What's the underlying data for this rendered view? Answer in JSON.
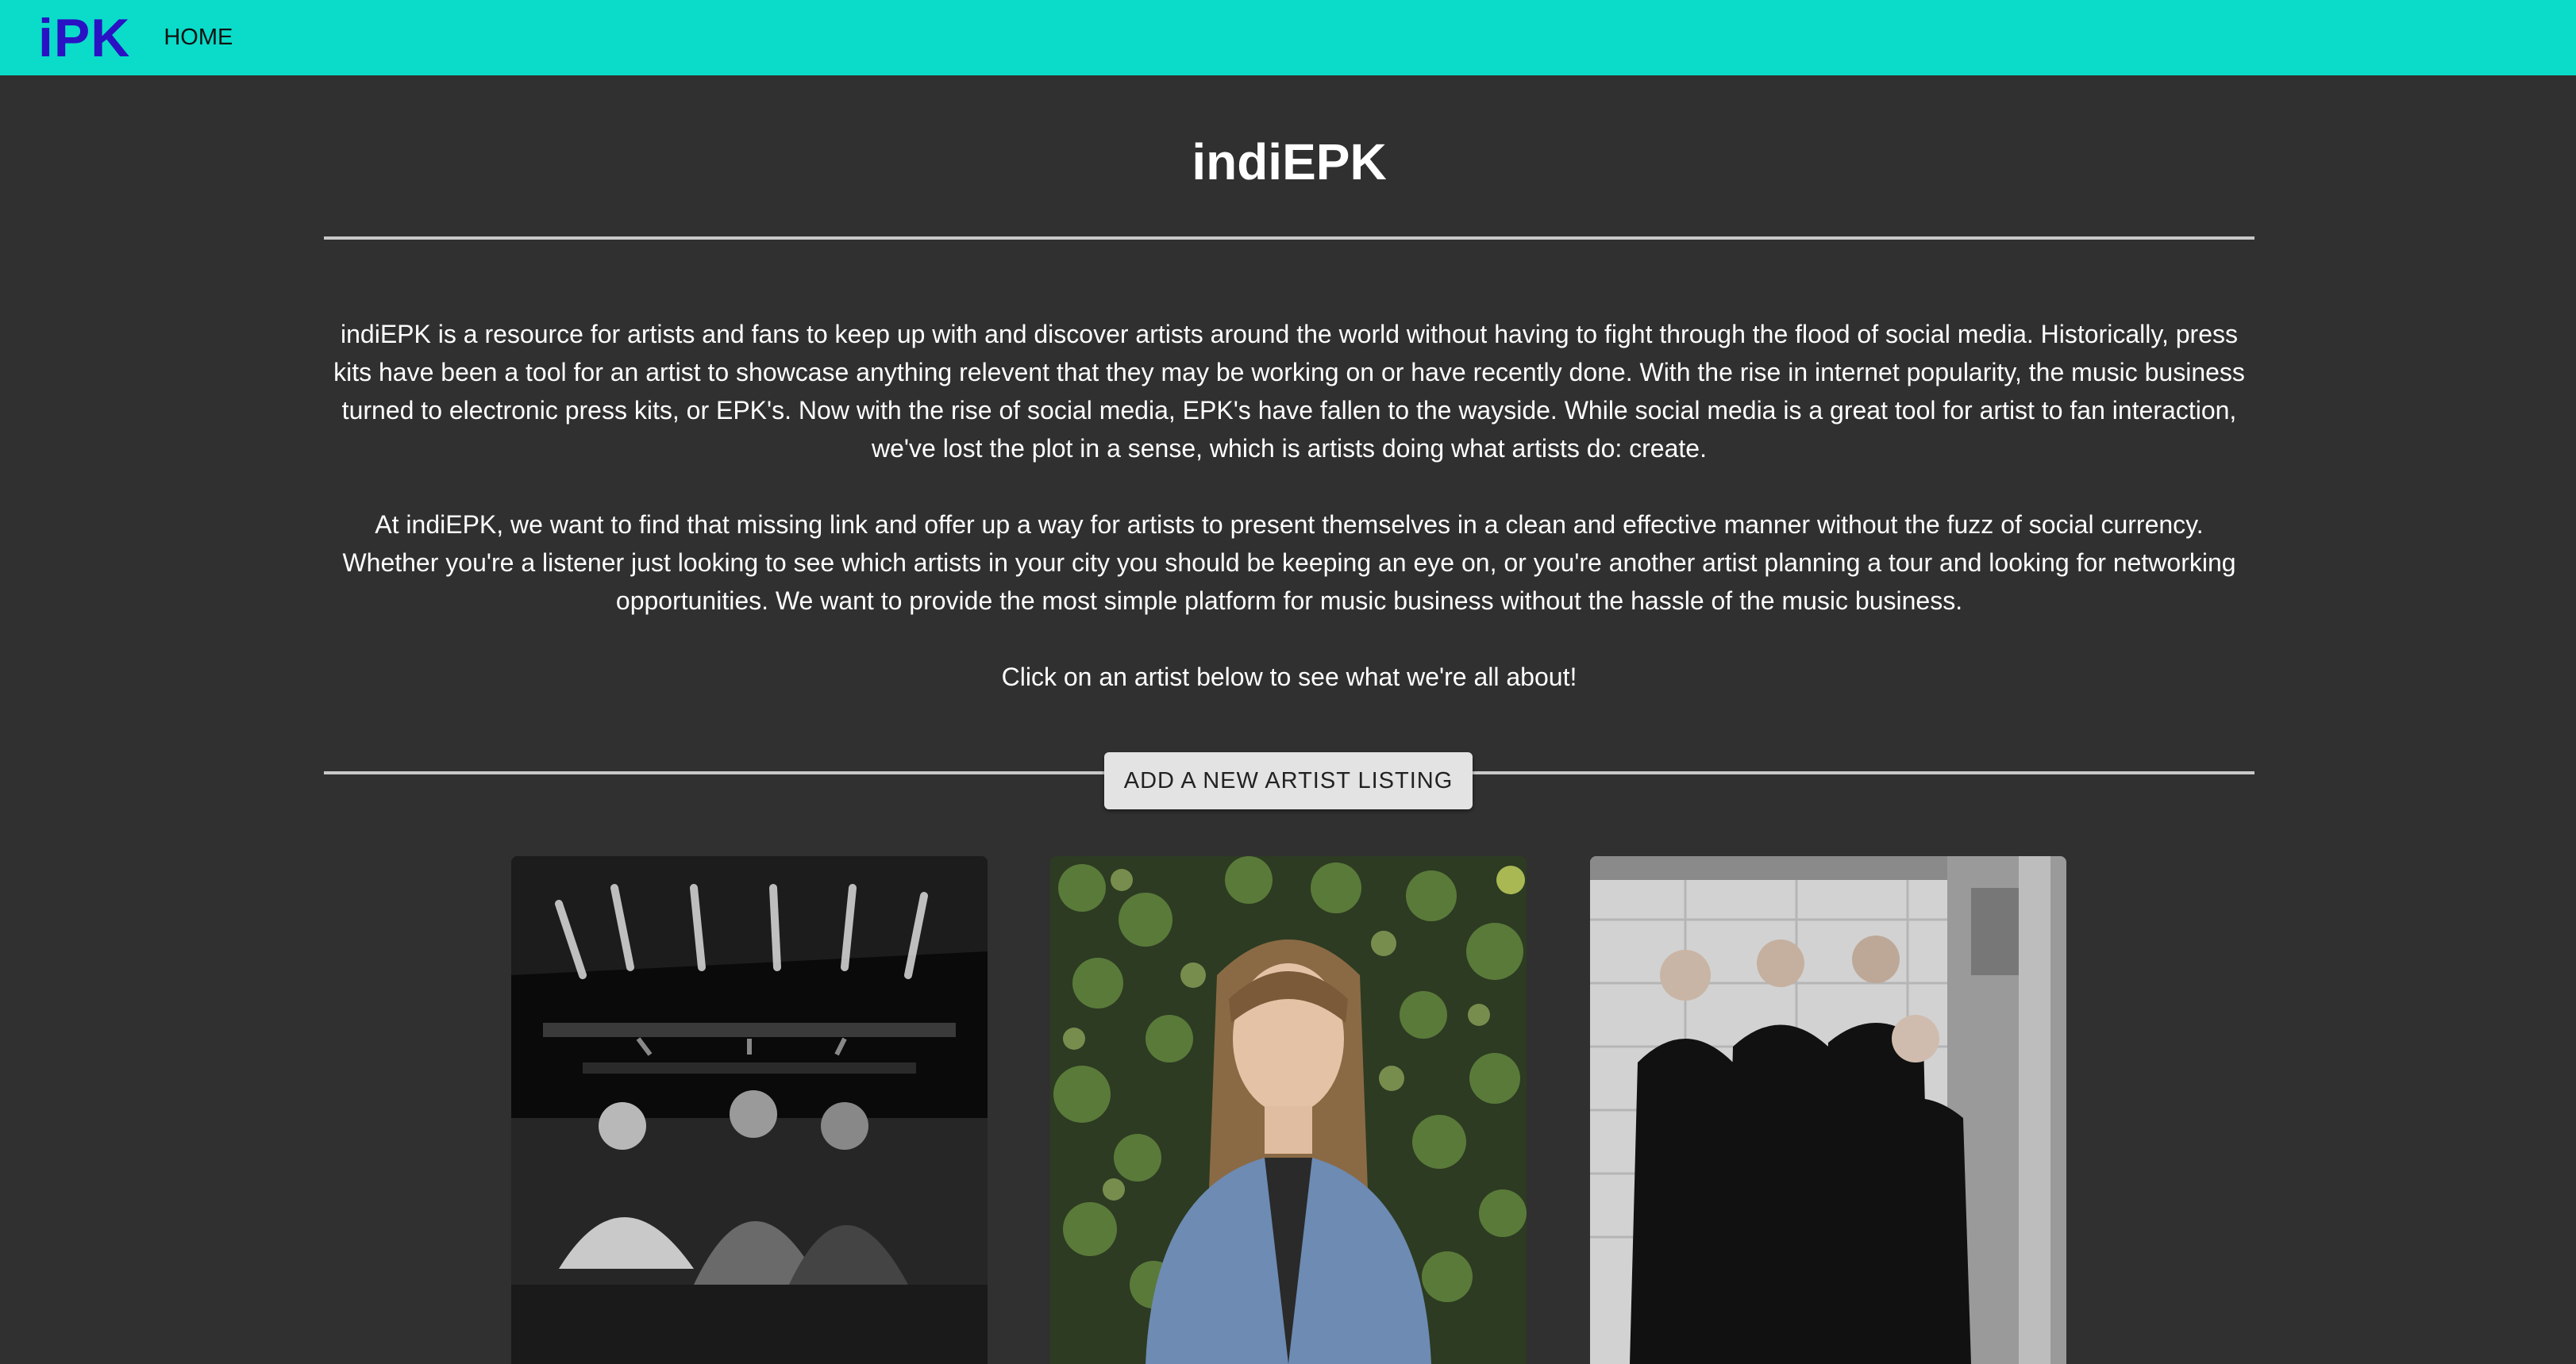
{
  "nav": {
    "brand": "iPK",
    "home_label": "HOME"
  },
  "main": {
    "title": "indiEPK",
    "paragraphs": [
      "indiEPK is a resource for artists and fans to keep up with and discover artists around the world without having to fight through the flood of social media. Historically, press kits have been a tool for an artist to showcase anything relevent that they may be working on or have recently done. With the rise in internet popularity, the music business turned to electronic press kits, or EPK's. Now with the rise of social media, EPK's have fallen to the wayside. While social media is a great tool for artist to fan interaction, we've lost the plot in a sense, which is artists doing what artists do: create.",
      "At indiEPK, we want to find that missing link and offer up a way for artists to present themselves in a clean and effective manner without the fuzz of social currency. Whether you're a listener just looking to see which artists in your city you should be keeping an eye on, or you're another artist planning a tour and looking for networking opportunities. We want to provide the most simple platform for music business without the hassle of the music business.",
      "Click on an artist below to see what we're all about!"
    ],
    "add_button_label": "ADD A NEW ARTIST LISTING"
  },
  "artists": [
    {
      "image": "band-photo-trio-couch-bw"
    },
    {
      "image": "artist-photo-long-hair-ivy"
    },
    {
      "image": "band-photo-five-piece-bw"
    }
  ],
  "colors": {
    "navbar": "#0adcc9",
    "brand": "#2a12c4",
    "background": "#303030",
    "divider": "#c8c8c8",
    "button": "#e3e3e3"
  }
}
